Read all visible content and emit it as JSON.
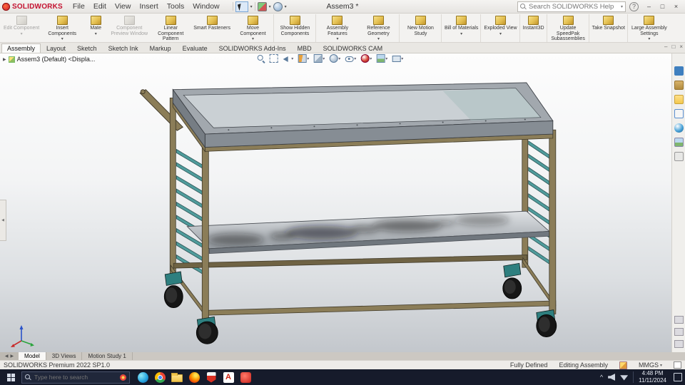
{
  "colors": {
    "brand_red": "#c41230",
    "taskbar_bg": "#161b2b",
    "frame_brown": "#8b7d58",
    "frame_dark": "#6f6344",
    "slat_teal": "#4f9b9b",
    "caster_teal": "#2e7f7f",
    "wheel_black": "#161616",
    "tray_rim": "#a2a8ae",
    "tray_floor": "#cad0d4",
    "tray_wall": "#868d94",
    "shelf_light": "#dfe2e5",
    "shelf_dark": "#989ea4"
  },
  "titlebar": {
    "brand": "SOLIDWORKS",
    "doc_title": "Assem3 *",
    "menus": [
      "File",
      "Edit",
      "View",
      "Insert",
      "Tools",
      "Window"
    ],
    "search_placeholder": "Search SOLIDWORKS Help",
    "help_glyph": "?",
    "controls": {
      "minimize": "–",
      "maximize": "□",
      "close": "×"
    }
  },
  "ribbon": {
    "buttons": [
      {
        "label": "Edit Component",
        "disabled": true,
        "caret": true
      },
      {
        "label": "Insert Components",
        "caret": true
      },
      {
        "label": "Mate",
        "caret": true
      },
      {
        "label": "Component Preview Window",
        "disabled": true
      },
      {
        "label": "Linear Component Pattern",
        "caret": true
      },
      {
        "label": "Smart Fasteners"
      },
      {
        "label": "Move Component",
        "caret": true,
        "sep": true
      },
      {
        "label": "Show Hidden Components",
        "sep": true
      },
      {
        "label": "Assembly Features",
        "caret": true
      },
      {
        "label": "Reference Geometry",
        "caret": true,
        "sep": true
      },
      {
        "label": "New Motion Study",
        "sep": true
      },
      {
        "label": "Bill of Materials",
        "caret": true,
        "sep": true
      },
      {
        "label": "Exploded View",
        "caret": true,
        "sep": true
      },
      {
        "label": "Instant3D",
        "sep": true
      },
      {
        "label": "Update SpeedPak Subassemblies",
        "sep": true
      },
      {
        "label": "Take Snapshot",
        "sep": true
      },
      {
        "label": "Large Assembly Settings",
        "caret": true
      }
    ]
  },
  "command_tabs": [
    {
      "label": "Assembly",
      "active": true
    },
    {
      "label": "Layout"
    },
    {
      "label": "Sketch"
    },
    {
      "label": "Sketch Ink"
    },
    {
      "label": "Markup"
    },
    {
      "label": "Evaluate"
    },
    {
      "label": "SOLIDWORKS Add-Ins"
    },
    {
      "label": "MBD"
    },
    {
      "label": "SOLIDWORKS CAM"
    }
  ],
  "doc_controls": {
    "minimize": "–",
    "maximize": "□",
    "close": "×"
  },
  "feature_tree": {
    "expand_arrow": "▶",
    "root_label": "Assem3 (Default) <Displa..."
  },
  "viewport": {
    "left_flyout_arrow": "◀"
  },
  "model_tabs": {
    "scroll_left": "◀",
    "scroll_right": "▶",
    "tabs": [
      {
        "label": "Model",
        "active": true
      },
      {
        "label": "3D Views"
      },
      {
        "label": "Motion Study 1"
      }
    ]
  },
  "statusbar": {
    "left": "SOLIDWORKS Premium 2022 SP1.0",
    "defined": "Fully Defined",
    "mode": "Editing Assembly",
    "units": "MMGS",
    "units_caret": "▾"
  },
  "taskbar": {
    "search_placeholder": "Type here to search",
    "a_letter": "A",
    "tray_chevron": "^",
    "time": "4:48 PM",
    "date": "11/11/2024"
  }
}
